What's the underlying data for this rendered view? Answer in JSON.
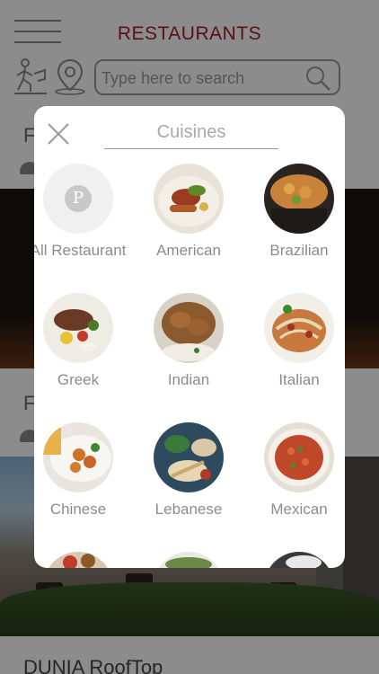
{
  "header": {
    "title": "RESTAURANTS",
    "search_placeholder": "Type here to search"
  },
  "background_rows": [
    {
      "label_fragment": "F"
    },
    {
      "label_fragment": "F"
    }
  ],
  "bottom_row": {
    "label": "DUNIA RoofTop"
  },
  "modal": {
    "title": "Cuisines",
    "items": [
      {
        "label": "All Restaurant",
        "badge": "P",
        "image": "all-restaurant-logo"
      },
      {
        "label": "American",
        "image": "american-dish"
      },
      {
        "label": "Brazilian",
        "image": "brazilian-dish"
      },
      {
        "label": "Greek",
        "image": "greek-dish"
      },
      {
        "label": "Indian",
        "image": "indian-dish"
      },
      {
        "label": "Italian",
        "image": "italian-dish"
      },
      {
        "label": "Chinese",
        "image": "chinese-dish"
      },
      {
        "label": "Lebanese",
        "image": "lebanese-dish"
      },
      {
        "label": "Mexican",
        "image": "mexican-dish"
      }
    ]
  },
  "colors": {
    "brand": "#a01f2a",
    "overlay": "rgba(0,0,0,0.45)",
    "label": "#8c8c8c"
  }
}
